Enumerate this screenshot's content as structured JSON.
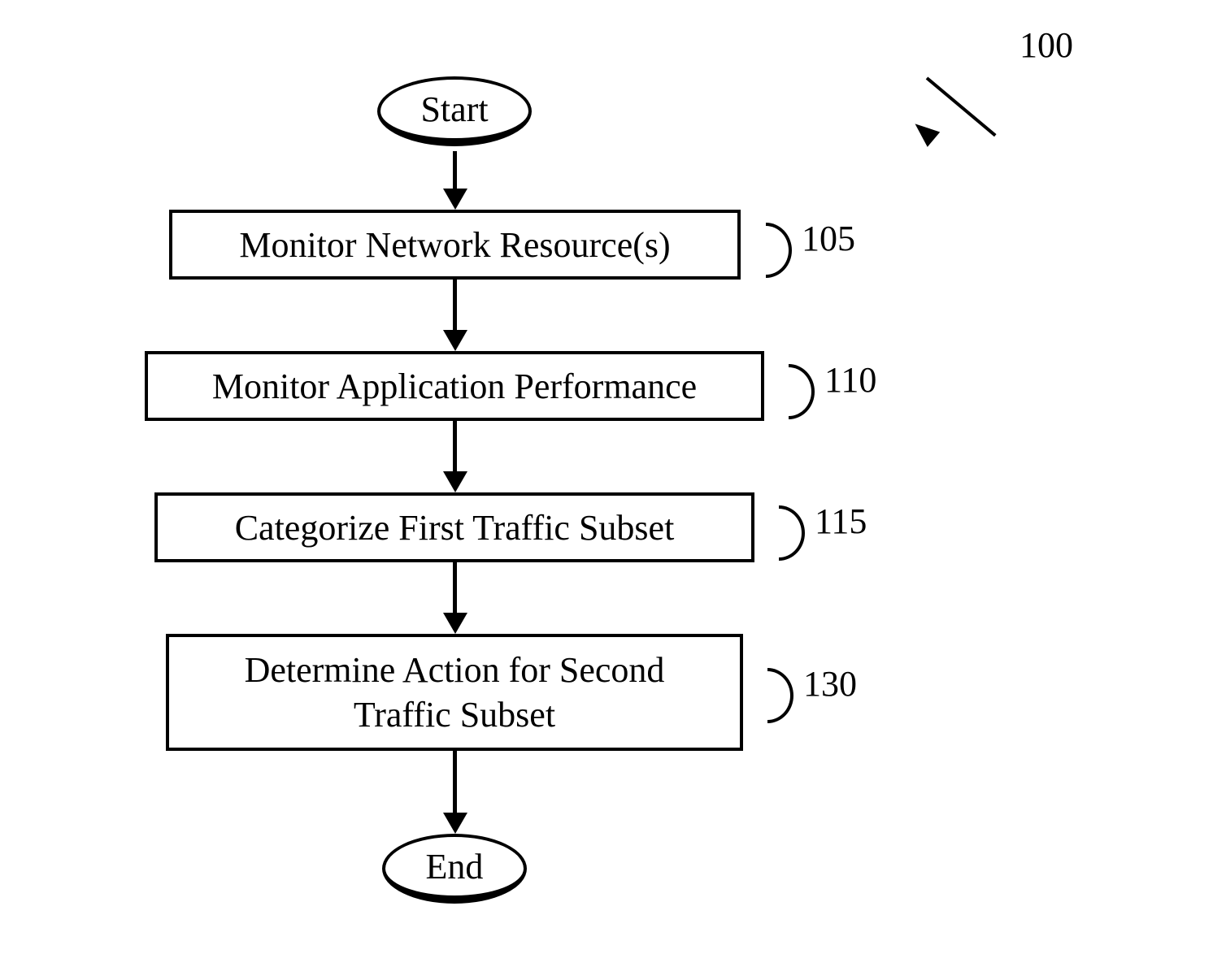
{
  "diagram": {
    "ref_main": "100",
    "start": "Start",
    "end": "End",
    "steps": [
      {
        "label": "Monitor Network Resource(s)",
        "ref": "105"
      },
      {
        "label": "Monitor Application Performance",
        "ref": "110"
      },
      {
        "label": "Categorize First Traffic Subset",
        "ref": "115"
      },
      {
        "label": "Determine Action for Second\nTraffic Subset",
        "ref": "130"
      }
    ]
  },
  "chart_data": {
    "type": "flowchart",
    "title": "",
    "nodes": [
      {
        "id": "start",
        "type": "terminal",
        "label": "Start"
      },
      {
        "id": "n105",
        "type": "process",
        "label": "Monitor Network Resource(s)",
        "ref": "105"
      },
      {
        "id": "n110",
        "type": "process",
        "label": "Monitor Application Performance",
        "ref": "110"
      },
      {
        "id": "n115",
        "type": "process",
        "label": "Categorize First Traffic Subset",
        "ref": "115"
      },
      {
        "id": "n130",
        "type": "process",
        "label": "Determine Action for Second Traffic Subset",
        "ref": "130"
      },
      {
        "id": "end",
        "type": "terminal",
        "label": "End"
      }
    ],
    "edges": [
      {
        "from": "start",
        "to": "n105"
      },
      {
        "from": "n105",
        "to": "n110"
      },
      {
        "from": "n110",
        "to": "n115"
      },
      {
        "from": "n115",
        "to": "n130"
      },
      {
        "from": "n130",
        "to": "end"
      }
    ],
    "figure_ref": "100"
  }
}
